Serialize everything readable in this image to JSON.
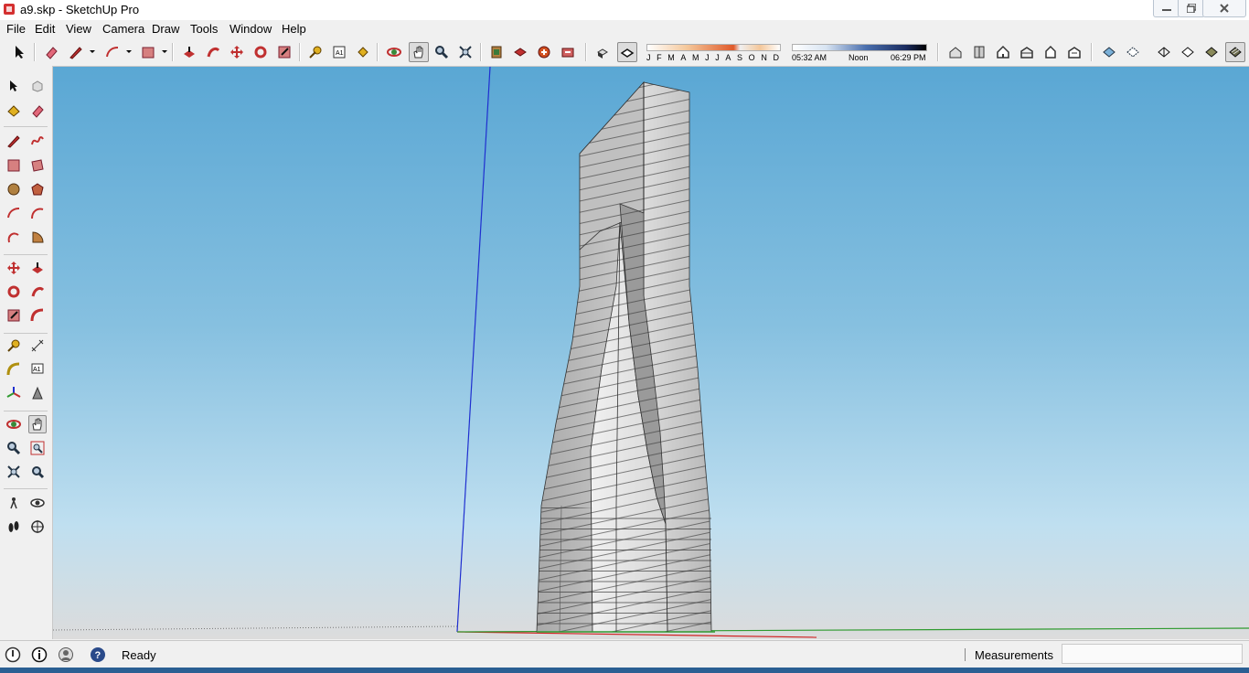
{
  "window": {
    "title": "a9.skp - SketchUp Pro",
    "minimize_icon": "minimize-icon",
    "restore_icon": "restore-icon",
    "close_icon": "close-icon"
  },
  "menu": [
    "File",
    "Edit",
    "View",
    "Camera",
    "Draw",
    "Tools",
    "Window",
    "Help"
  ],
  "toolbar": {
    "months": [
      "J",
      "F",
      "M",
      "A",
      "M",
      "J",
      "J",
      "A",
      "S",
      "O",
      "N",
      "D"
    ],
    "time_start": "05:32 AM",
    "time_mid": "Noon",
    "time_end": "06:29 PM"
  },
  "status": {
    "text": "Ready",
    "measurements_label": "Measurements",
    "measurements_value": ""
  },
  "colors": {
    "sky_top": "#5aa7d4",
    "sky_bottom": "#bfdff0",
    "blue_axis": "#1f2fd0",
    "red_axis": "#d02020",
    "green_axis": "#2f9a2f"
  }
}
